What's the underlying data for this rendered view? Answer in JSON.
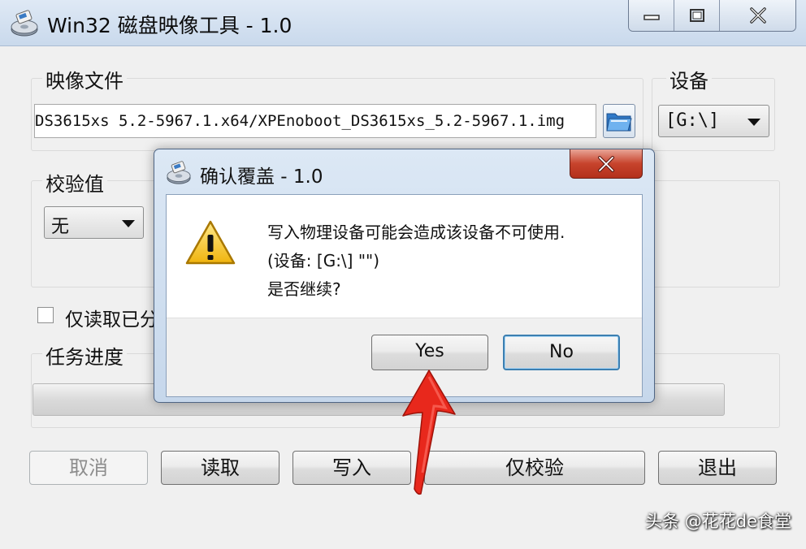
{
  "main_window": {
    "title": "Win32 磁盘映像工具 - 1.0",
    "image_file": {
      "label": "映像文件",
      "path": "DS3615xs 5.2-5967.1.x64/XPEnoboot_DS3615xs_5.2-5967.1.img"
    },
    "device": {
      "label": "设备",
      "value": "[G:\\]"
    },
    "hash": {
      "label": "校验值",
      "value": "无"
    },
    "readonly_checkbox": {
      "label": "仅读取已分",
      "checked": false
    },
    "progress": {
      "label": "任务进度",
      "value": 0
    },
    "buttons": {
      "cancel": "取消",
      "read": "读取",
      "write": "写入",
      "verify_only": "仅校验",
      "exit": "退出"
    }
  },
  "dialog": {
    "title": "确认覆盖 - 1.0",
    "message_lines": [
      "写入物理设备可能会造成该设备不可使用.",
      "(设备: [G:\\] \"\")",
      "是否继续?"
    ],
    "yes_label": "Yes",
    "no_label": "No"
  },
  "watermark": "头条 @花花de食堂",
  "colors": {
    "annotation_arrow": "#e8281c",
    "dialog_close": "#c7432c",
    "default_button_border": "#3c7fb1"
  },
  "icons": {
    "app": "disk-imager-icon",
    "folder": "open-folder-icon",
    "warning": "warning-icon"
  }
}
